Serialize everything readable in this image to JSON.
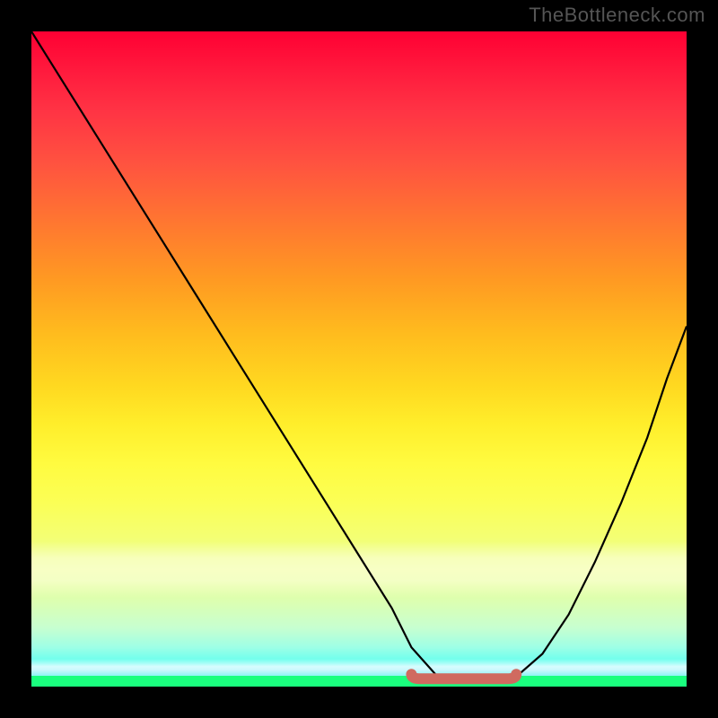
{
  "watermark": "TheBottleneck.com",
  "chart_data": {
    "type": "line",
    "title": "",
    "xlabel": "",
    "ylabel": "",
    "xlim": [
      0,
      100
    ],
    "ylim": [
      0,
      100
    ],
    "grid": false,
    "legend": false,
    "series": [
      {
        "name": "curve",
        "x": [
          0,
          5,
          10,
          15,
          20,
          25,
          30,
          35,
          40,
          45,
          50,
          55,
          58,
          62,
          66,
          70,
          74,
          78,
          82,
          86,
          90,
          94,
          97,
          100
        ],
        "y": [
          100,
          92,
          84,
          76,
          68,
          60,
          52,
          44,
          36,
          28,
          20,
          12,
          6,
          1.5,
          0.8,
          0.8,
          1.5,
          5,
          11,
          19,
          28,
          38,
          47,
          55
        ]
      }
    ],
    "marker_segment": {
      "name": "trough-highlight",
      "x_start": 58,
      "x_end": 74,
      "y": 1.2
    },
    "background": {
      "gradient_top": "#ff0033",
      "gradient_mid": "#ffee2b",
      "gradient_bottom": "#1aff88"
    }
  }
}
